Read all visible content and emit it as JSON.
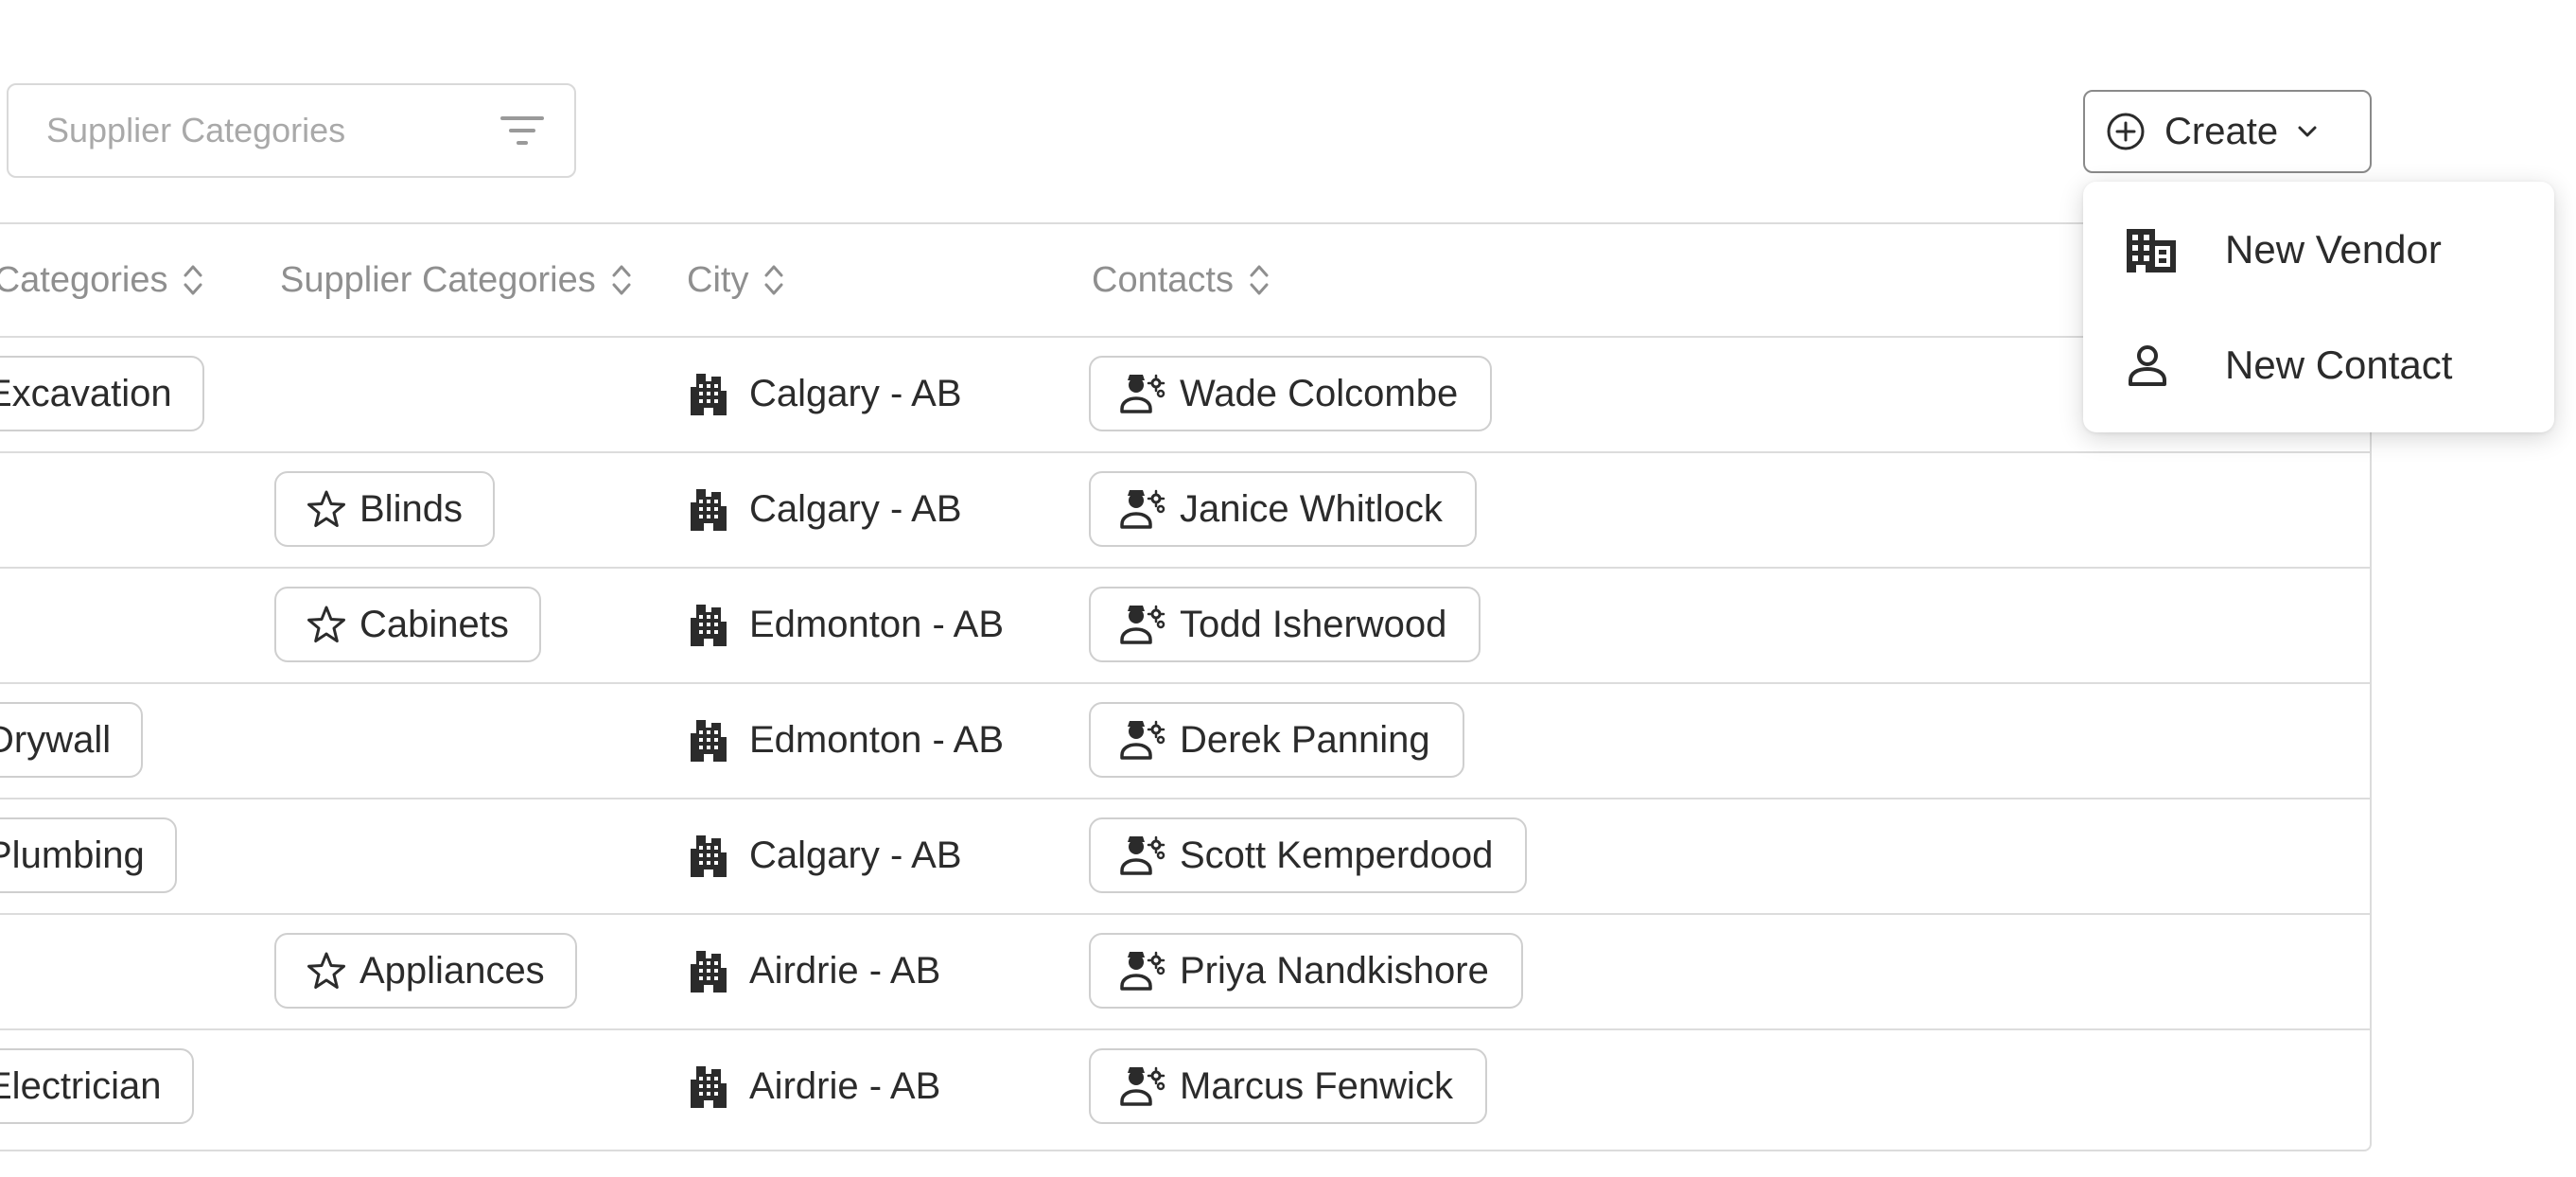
{
  "filter": {
    "placeholder": "Supplier Categories",
    "icon": "filter-icon"
  },
  "create_button": {
    "label": "Create",
    "icon": "plus-circle-icon",
    "caret_icon": "chevron-down-icon"
  },
  "create_menu": {
    "items": [
      {
        "label": "New Vendor",
        "icon": "building-icon"
      },
      {
        "label": "New Contact",
        "icon": "person-icon"
      }
    ]
  },
  "table": {
    "columns": [
      {
        "label": "Trade Categories",
        "visible_text": "e Categories"
      },
      {
        "label": "Supplier Categories"
      },
      {
        "label": "City"
      },
      {
        "label": "Contacts"
      }
    ],
    "rows": [
      {
        "trade": "Excavation",
        "supplier": "",
        "city": "Calgary - AB",
        "contact": "Wade Colcombe"
      },
      {
        "trade": "",
        "supplier": "Blinds",
        "city": "Calgary - AB",
        "contact": "Janice Whitlock"
      },
      {
        "trade": "",
        "supplier": "Cabinets",
        "city": "Edmonton - AB",
        "contact": "Todd Isherwood"
      },
      {
        "trade": "Drywall",
        "supplier": "",
        "city": "Edmonton - AB",
        "contact": "Derek Panning"
      },
      {
        "trade": "Plumbing",
        "supplier": "",
        "city": "Calgary - AB",
        "contact": "Scott Kemperdood"
      },
      {
        "trade": "",
        "supplier": "Appliances",
        "city": "Airdrie - AB",
        "contact": "Priya Nandkishore"
      },
      {
        "trade": "Electrician",
        "supplier": "",
        "city": "Airdrie - AB",
        "contact": "Marcus Fenwick"
      }
    ]
  },
  "colors": {
    "border": "#dcdcdc",
    "chip_border": "#cfcfcf",
    "header_text": "#8f8f8f",
    "placeholder_text": "#a9a9a9",
    "text": "#2b2b2b"
  }
}
